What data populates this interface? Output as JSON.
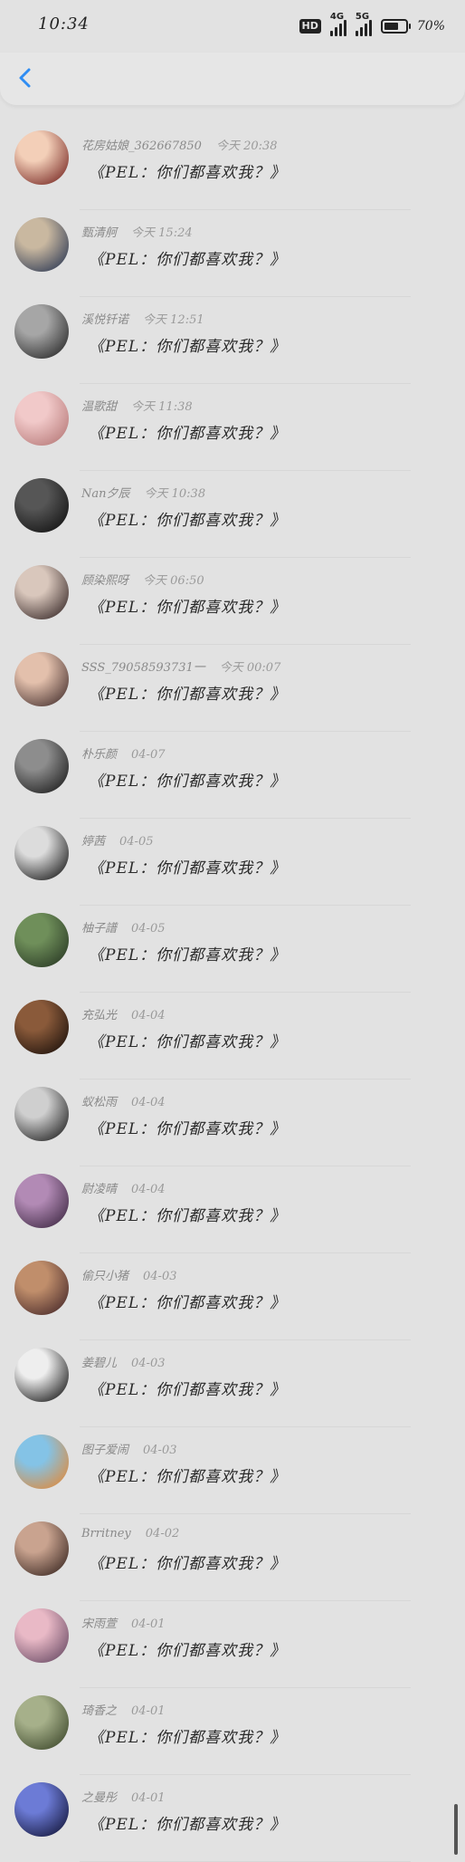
{
  "status": {
    "time": "10:34",
    "hd_label": "HD",
    "network_1": "4G",
    "network_2": "5G",
    "battery_text": "70%",
    "battery_level": 0.7
  },
  "colors": {
    "accent": "#2f8df3",
    "background": "#e2e2e2"
  },
  "items": [
    {
      "name": "花房姑娘_362667850",
      "time": "今天 20:38",
      "message": "《PEL：你们都喜欢我？》",
      "avatar_colors": [
        "#f3cfb8",
        "#7a2b26"
      ]
    },
    {
      "name": "甄清舸",
      "time": "今天 15:24",
      "message": "《PEL：你们都喜欢我？》",
      "avatar_colors": [
        "#c9b8a0",
        "#2f3b55"
      ]
    },
    {
      "name": "溪悦钎诺",
      "time": "今天 12:51",
      "message": "《PEL：你们都喜欢我？》",
      "avatar_colors": [
        "#a6a6a6",
        "#2a2a2a"
      ]
    },
    {
      "name": "温歌甜",
      "time": "今天 11:38",
      "message": "《PEL：你们都喜欢我？》",
      "avatar_colors": [
        "#f1c9c9",
        "#b77a79"
      ]
    },
    {
      "name": "Nan夕辰",
      "time": "今天 10:38",
      "message": "《PEL：你们都喜欢我？》",
      "avatar_colors": [
        "#565656",
        "#121212"
      ]
    },
    {
      "name": "顾染熙呀",
      "time": "今天 06:50",
      "message": "《PEL：你们都喜欢我？》",
      "avatar_colors": [
        "#d9c7bc",
        "#3b2c2b"
      ]
    },
    {
      "name": "SSS_79058593731一",
      "time": "今天 00:07",
      "message": "《PEL：你们都喜欢我？》",
      "avatar_colors": [
        "#e3c0ac",
        "#4a3432"
      ]
    },
    {
      "name": "朴乐颜",
      "time": "04-07",
      "message": "《PEL：你们都喜欢我？》",
      "avatar_colors": [
        "#8d8d8d",
        "#1e1e1e"
      ]
    },
    {
      "name": "婷茜",
      "time": "04-05",
      "message": "《PEL：你们都喜欢我？》",
      "avatar_colors": [
        "#dcdcdc",
        "#1c1c1c"
      ]
    },
    {
      "name": "柚子譜",
      "time": "04-05",
      "message": "《PEL：你们都喜欢我？》",
      "avatar_colors": [
        "#6f8f5a",
        "#2a3a25"
      ]
    },
    {
      "name": "充弘光",
      "time": "04-04",
      "message": "《PEL：你们都喜欢我？》",
      "avatar_colors": [
        "#8a5a3a",
        "#1e120c"
      ]
    },
    {
      "name": "蚁松雨",
      "time": "04-04",
      "message": "《PEL：你们都喜欢我？》",
      "avatar_colors": [
        "#cfcfcf",
        "#222222"
      ]
    },
    {
      "name": "尉凌晴",
      "time": "04-04",
      "message": "《PEL：你们都喜欢我？》",
      "avatar_colors": [
        "#b28ab5",
        "#412b46"
      ]
    },
    {
      "name": "偷只小猪",
      "time": "04-03",
      "message": "《PEL：你们都喜欢我？》",
      "avatar_colors": [
        "#c08e6b",
        "#4a2b2b"
      ]
    },
    {
      "name": "姜碧儿",
      "time": "04-03",
      "message": "《PEL：你们都喜欢我？》",
      "avatar_colors": [
        "#eeeeee",
        "#1a1a1a"
      ]
    },
    {
      "name": "图子爱闹",
      "time": "04-03",
      "message": "《PEL：你们都喜欢我？》",
      "avatar_colors": [
        "#84c3e6",
        "#e08a3b"
      ]
    },
    {
      "name": "Brritney",
      "time": "04-02",
      "message": "《PEL：你们都喜欢我？》",
      "avatar_colors": [
        "#c9a38f",
        "#3d2a24"
      ]
    },
    {
      "name": "宋雨萱",
      "time": "04-01",
      "message": "《PEL：你们都喜欢我？》",
      "avatar_colors": [
        "#e9b9c6",
        "#6b4c66"
      ]
    },
    {
      "name": "琦香之",
      "time": "04-01",
      "message": "《PEL：你们都喜欢我？》",
      "avatar_colors": [
        "#a6b08a",
        "#3f4a2d"
      ]
    },
    {
      "name": "之曼彤",
      "time": "04-01",
      "message": "《PEL：你们都喜欢我？》",
      "avatar_colors": [
        "#6c7bd6",
        "#15183d"
      ]
    }
  ]
}
